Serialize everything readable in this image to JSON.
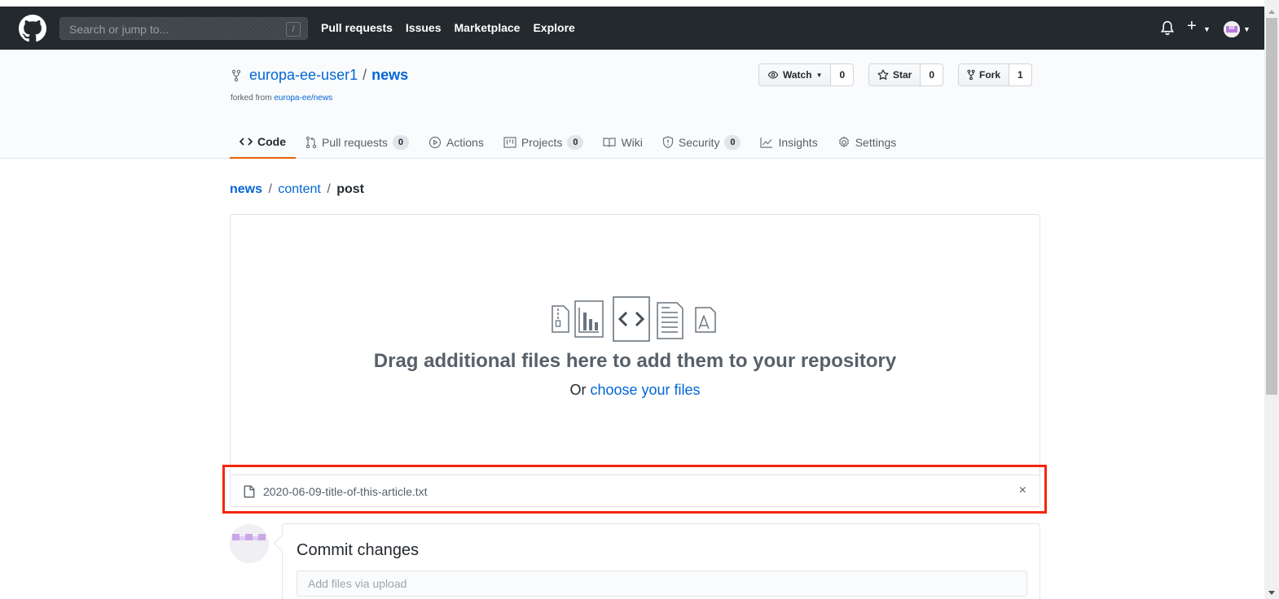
{
  "header": {
    "search_placeholder": "Search or jump to...",
    "search_shortcut": "/",
    "nav": [
      "Pull requests",
      "Issues",
      "Marketplace",
      "Explore"
    ]
  },
  "repo": {
    "owner": "europa-ee-user1",
    "separator": "/",
    "name": "news",
    "forked_prefix": "forked from",
    "forked_source": "europa-ee/news",
    "watch": {
      "label": "Watch",
      "count": "0"
    },
    "star": {
      "label": "Star",
      "count": "0"
    },
    "fork": {
      "label": "Fork",
      "count": "1"
    }
  },
  "tabs": {
    "code": "Code",
    "pull_requests": {
      "label": "Pull requests",
      "count": "0"
    },
    "actions": "Actions",
    "projects": {
      "label": "Projects",
      "count": "0"
    },
    "wiki": "Wiki",
    "security": {
      "label": "Security",
      "count": "0"
    },
    "insights": "Insights",
    "settings": "Settings"
  },
  "breadcrumb": {
    "root": "news",
    "sep": "/",
    "middle": "content",
    "final": "post"
  },
  "upload": {
    "drag_text": "Drag additional files here to add them to your repository",
    "or_text": "Or",
    "choose_link": "choose your files",
    "file_name": "2020-06-09-title-of-this-article.txt",
    "remove_symbol": "×"
  },
  "commit": {
    "title": "Commit changes",
    "input_placeholder": "Add files via upload"
  },
  "colors": {
    "header_bg": "#24292e",
    "link": "#0366d6",
    "tab_underline": "#e36209",
    "highlight": "#f4270e"
  }
}
